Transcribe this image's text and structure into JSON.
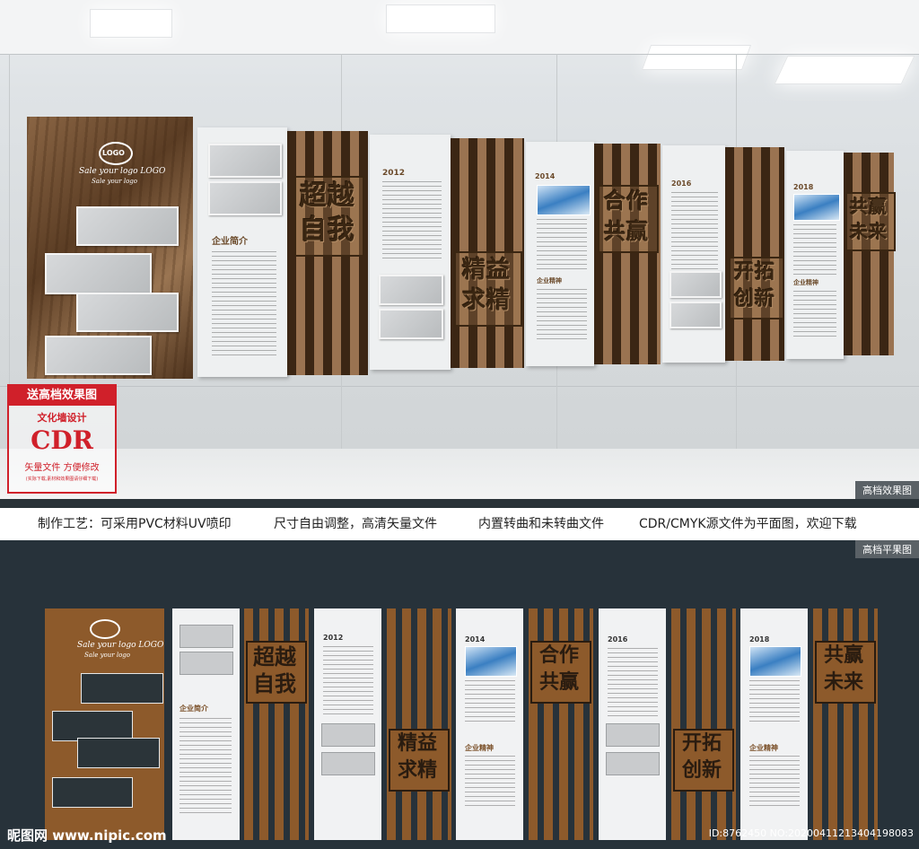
{
  "promo": {
    "headline": "送高档效果图",
    "subtitle": "文化墙设计",
    "format": "CDR",
    "note": "矢量文件 方便修改",
    "small": "(实际下载,素材和效果图请仔细下载)"
  },
  "render_label": "高档效果图",
  "flat_label": "高档平果图",
  "caption": {
    "item1": "制作工艺：可采用PVC材料UV喷印",
    "item2": "尺寸自由调整，高清矢量文件",
    "item3": "内置转曲和未转曲文件",
    "item4": "CDR/CMYK源文件为平面图，欢迎下载"
  },
  "logo": {
    "mark": "LOGO",
    "slogan": "Sale your logo LOGO",
    "tagline": "Sale your logo"
  },
  "years": [
    "2012",
    "2014",
    "2016",
    "2018"
  ],
  "section_title": "企业简介",
  "section_tag": "企业精神",
  "slogans": {
    "s1": [
      "超越",
      "自我"
    ],
    "s2": [
      "精益",
      "求精"
    ],
    "s3": [
      "合作",
      "共赢"
    ],
    "s4": [
      "开拓",
      "创新"
    ],
    "s5": [
      "共赢",
      "未来"
    ]
  },
  "footer": {
    "site": "昵图网 www.nipic.com",
    "id": "ID:8762450 NO:20200411213404198083"
  },
  "colors": {
    "brown": "#8d5a2b",
    "dark": "#27323a",
    "promo_red": "#d0202a"
  }
}
